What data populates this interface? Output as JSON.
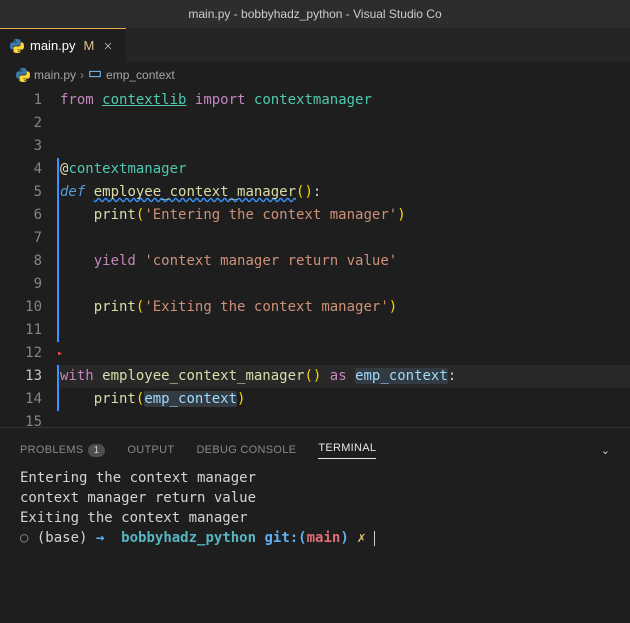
{
  "titleBar": "main.py - bobbyhadz_python - Visual Studio Co",
  "tab": {
    "title": "main.py",
    "modified": "M"
  },
  "breadcrumb": {
    "file": "main.py",
    "symbol": "emp_context"
  },
  "code": {
    "lines": [
      "1",
      "2",
      "3",
      "4",
      "5",
      "6",
      "7",
      "8",
      "9",
      "10",
      "11",
      "12",
      "13",
      "14",
      "15"
    ],
    "l1": {
      "from": "from",
      "module": "contextlib",
      "import": "import",
      "name": "contextmanager"
    },
    "l4": {
      "at": "@",
      "dec": "contextmanager"
    },
    "l5": {
      "def": "def",
      "fn": "employee_context_manager",
      "p1": "(",
      "p2": ")",
      "colon": ":"
    },
    "l6": {
      "fn": "print",
      "p1": "(",
      "str": "'Entering the context manager'",
      "p2": ")"
    },
    "l8": {
      "kw": "yield",
      "str": "'context manager return value'"
    },
    "l10": {
      "fn": "print",
      "p1": "(",
      "str": "'Exiting the context manager'",
      "p2": ")"
    },
    "l13": {
      "with": "with",
      "fn": "employee_context_manager",
      "p1": "(",
      "p2": ")",
      "as": "as",
      "var": "emp_context",
      "colon": ":"
    },
    "l14": {
      "fn": "print",
      "p1": "(",
      "var": "emp_context",
      "p2": ")"
    }
  },
  "panel": {
    "problems": "PROBLEMS",
    "problemsCount": "1",
    "output": "OUTPUT",
    "debug": "DEBUG CONSOLE",
    "terminal": "TERMINAL"
  },
  "terminal": {
    "l1": "Entering the context manager",
    "l2": "context manager return value",
    "l3": "Exiting the context manager",
    "prompt": {
      "base": "(base)",
      "arrow": "→",
      "dir": "bobbyhadz_python",
      "gitPre": "git:(",
      "branch": "main",
      "gitPost": ")",
      "x": "✗"
    }
  }
}
